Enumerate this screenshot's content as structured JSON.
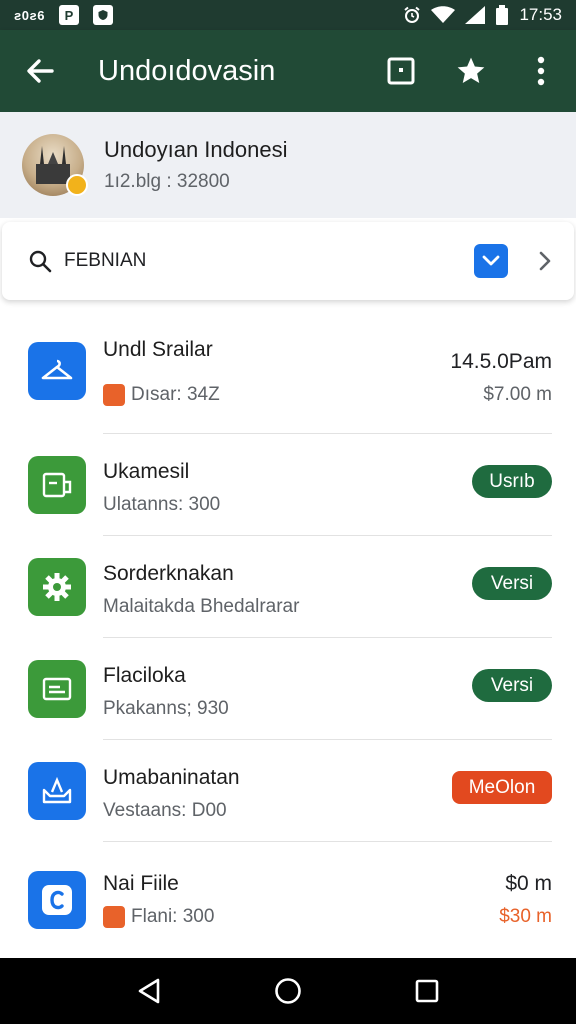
{
  "status_bar": {
    "carrier": "ƨ0ƨ6",
    "time": "17:53"
  },
  "app_bar": {
    "title": "Undoıdovasin"
  },
  "profile": {
    "name": "Undoyıan Indonesi",
    "subtitle": "1ı2.blg : 32800"
  },
  "search": {
    "value": "FEBNIAN"
  },
  "list": {
    "items": [
      {
        "title": "Undl Srailar",
        "subtitle": "Dısar: 34Z",
        "right_top": "14.5.0Pam",
        "right_bottom": "$7.00 m",
        "icon": "hanger-icon",
        "icon_color": "#1a73e8",
        "sub_glyph_color": "#e8622a"
      },
      {
        "title": "Ukamesil",
        "subtitle": "Ulatanns: 300",
        "badge": "Usrıb",
        "icon": "card-reader-icon",
        "icon_color": "#3c9a3a"
      },
      {
        "title": "Sorderknakan",
        "subtitle": "Malaitakda Bhedalrarar",
        "badge": "Versi",
        "icon": "gear-icon",
        "icon_color": "#3c9a3a"
      },
      {
        "title": "Flaciloka",
        "subtitle": "Pkakanns; 930",
        "badge": "Versi",
        "icon": "card-icon",
        "icon_color": "#3c9a3a"
      },
      {
        "title": "Umabaninatan",
        "subtitle": "Vestaans: D00",
        "badge": "MeOlon",
        "icon": "tray-icon",
        "icon_color": "#1a73e8"
      },
      {
        "title": "Nai Fiile",
        "subtitle": "Flani: 300",
        "right_top": "$0 m",
        "right_bottom": "$30 m",
        "icon": "c-letter-icon",
        "icon_color": "#1a73e8",
        "sub_glyph_color": "#e8622a",
        "right_bottom_color": "#e8622a"
      }
    ]
  },
  "colors": {
    "app_bar": "#214a36",
    "pill_green": "#1f6b3f",
    "pill_orange": "#e2491f",
    "accent_blue": "#1a73e8"
  }
}
